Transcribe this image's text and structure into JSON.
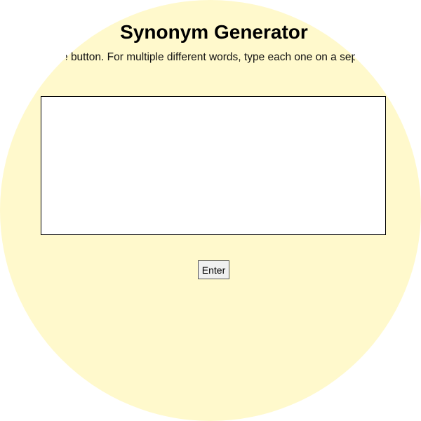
{
  "page": {
    "title": "Synonym Generator",
    "instructions": "Type a word into the text box and click the button. For multiple different words, type each one on a separate line.",
    "background_color": "#fff9cc"
  },
  "form": {
    "words_input_value": "",
    "enter_label": "Enter"
  }
}
